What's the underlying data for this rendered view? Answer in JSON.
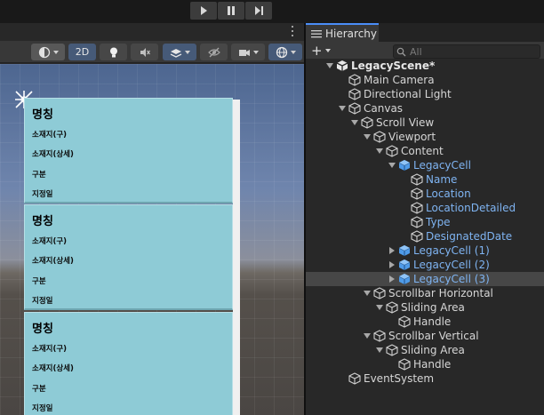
{
  "playbar": {
    "play_icon": "play-icon",
    "pause_icon": "pause-icon",
    "step_icon": "step-icon"
  },
  "scene_toolbar": {
    "mode_2d_label": "2D"
  },
  "scene_view": {
    "cell_title": "명칭",
    "cell_rows": [
      "소재지(구)",
      "소재지(상세)",
      "구분",
      "지정일"
    ]
  },
  "hierarchy": {
    "tab_label": "Hierarchy",
    "search_placeholder": "All",
    "nodes": [
      {
        "label": "LegacyScene*",
        "depth": 0,
        "arrow": "down",
        "kind": "scene"
      },
      {
        "label": "Main Camera",
        "depth": 1,
        "arrow": "",
        "kind": "object"
      },
      {
        "label": "Directional Light",
        "depth": 1,
        "arrow": "",
        "kind": "object"
      },
      {
        "label": "Canvas",
        "depth": 1,
        "arrow": "down",
        "kind": "object"
      },
      {
        "label": "Scroll View",
        "depth": 2,
        "arrow": "down",
        "kind": "object"
      },
      {
        "label": "Viewport",
        "depth": 3,
        "arrow": "down",
        "kind": "object"
      },
      {
        "label": "Content",
        "depth": 4,
        "arrow": "down",
        "kind": "object"
      },
      {
        "label": "LegacyCell",
        "depth": 5,
        "arrow": "down",
        "kind": "prefab"
      },
      {
        "label": "Name",
        "depth": 6,
        "arrow": "",
        "kind": "prefab-child"
      },
      {
        "label": "Location",
        "depth": 6,
        "arrow": "",
        "kind": "prefab-child"
      },
      {
        "label": "LocationDetailed",
        "depth": 6,
        "arrow": "",
        "kind": "prefab-child"
      },
      {
        "label": "Type",
        "depth": 6,
        "arrow": "",
        "kind": "prefab-child"
      },
      {
        "label": "DesignatedDate",
        "depth": 6,
        "arrow": "",
        "kind": "prefab-child"
      },
      {
        "label": "LegacyCell (1)",
        "depth": 5,
        "arrow": "right",
        "kind": "prefab"
      },
      {
        "label": "LegacyCell (2)",
        "depth": 5,
        "arrow": "right",
        "kind": "prefab"
      },
      {
        "label": "LegacyCell (3)",
        "depth": 5,
        "arrow": "right",
        "kind": "prefab",
        "selected": true
      },
      {
        "label": "Scrollbar Horizontal",
        "depth": 3,
        "arrow": "down",
        "kind": "object"
      },
      {
        "label": "Sliding Area",
        "depth": 4,
        "arrow": "down",
        "kind": "object"
      },
      {
        "label": "Handle",
        "depth": 5,
        "arrow": "",
        "kind": "object"
      },
      {
        "label": "Scrollbar Vertical",
        "depth": 3,
        "arrow": "down",
        "kind": "object"
      },
      {
        "label": "Sliding Area",
        "depth": 4,
        "arrow": "down",
        "kind": "object"
      },
      {
        "label": "Handle",
        "depth": 5,
        "arrow": "",
        "kind": "object"
      },
      {
        "label": "EventSystem",
        "depth": 1,
        "arrow": "",
        "kind": "object"
      }
    ]
  },
  "colors": {
    "accent": "#4a8df8",
    "prefab_text": "#7fb4f2",
    "cell_bg": "#8ecbd6"
  }
}
